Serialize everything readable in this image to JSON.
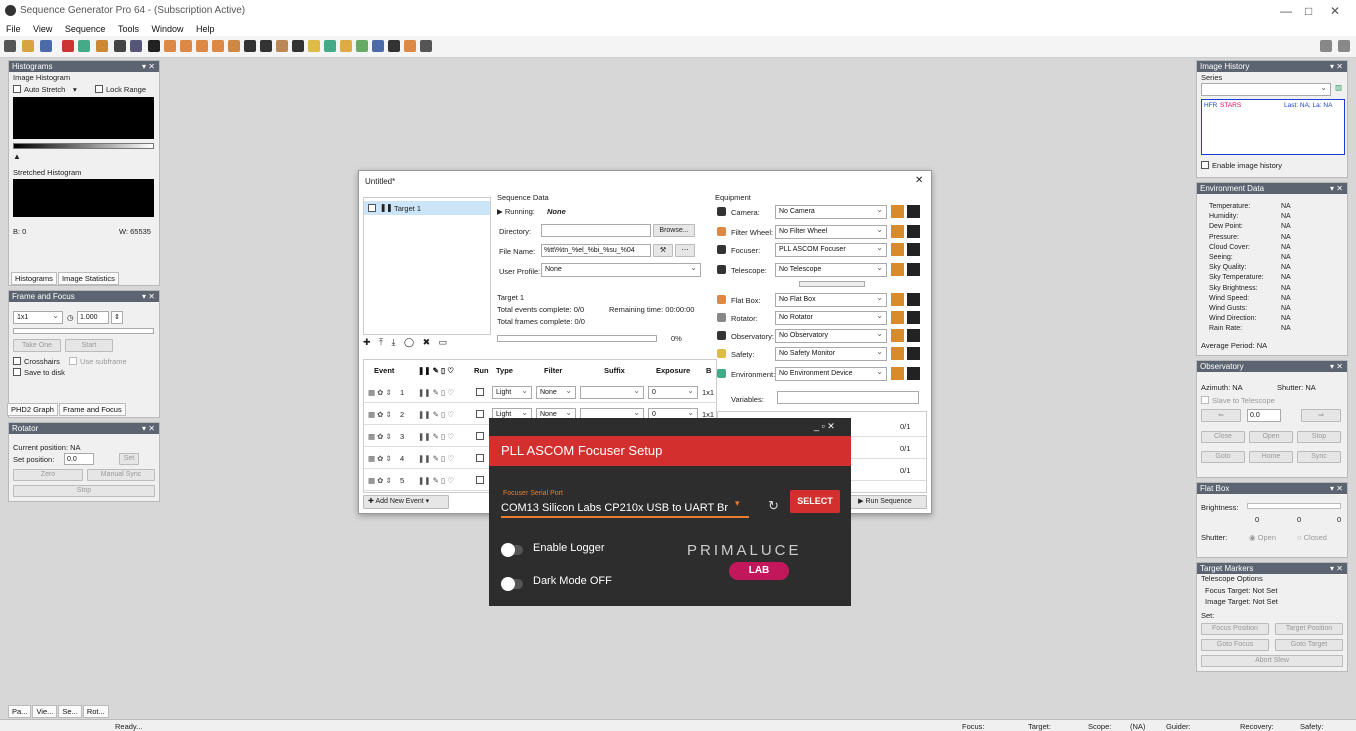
{
  "window": {
    "title": "Sequence Generator Pro 64 - (Subscription Active)",
    "minimize": "—",
    "maximize": "□",
    "close": "✕"
  },
  "menu": [
    "File",
    "View",
    "Sequence",
    "Tools",
    "Window",
    "Help"
  ],
  "left": {
    "histograms": {
      "title": "Histograms",
      "image_histogram": "Image Histogram",
      "auto_stretch": "Auto Stretch",
      "lock_range": "Lock Range",
      "stretched": "Stretched Histogram",
      "b": "B: 0",
      "w": "W: 65535",
      "tab_hist": "Histograms",
      "tab_stats": "Image Statistics"
    },
    "frame_focus": {
      "title": "Frame and Focus",
      "binning": "1x1",
      "exposure": "1.000",
      "take_one": "Take One",
      "start": "Start",
      "crosshairs": "Crosshairs",
      "use_subframe": "Use subframe",
      "save_to_disk": "Save to disk",
      "tab_phd2": "PHD2 Graph",
      "tab_ff": "Frame and Focus"
    },
    "rotator": {
      "title": "Rotator",
      "current": "Current position: NA",
      "set_position": "Set position:",
      "set_value": "0.0",
      "set": "Set",
      "zero": "Zero",
      "manual_sync": "Manual Sync",
      "stop": "Stop"
    },
    "bottom_tabs": [
      "Pa...",
      "Vie...",
      "Se...",
      "Rot..."
    ],
    "status": "Ready..."
  },
  "dialog": {
    "title": "Untitled*",
    "close": "✕",
    "target": "Target 1",
    "seq_data": {
      "header": "Sequence Data",
      "running_lbl": "Running:",
      "running_val": "None",
      "directory_lbl": "Directory:",
      "browse": "Browse...",
      "filename_lbl": "File Name:",
      "filename_val": "%tt\\%tn_%el_%bi_%su_%04",
      "profile_lbl": "User Profile:",
      "profile_val": "None"
    },
    "target_box": {
      "header": "Target 1",
      "events": "Total events complete: 0/0",
      "remaining": "Remaining time: 00:00:00",
      "frames": "Total frames complete: 0/0",
      "pct": "0%"
    },
    "equipment": {
      "header": "Equipment",
      "rows": [
        {
          "label": "Camera:",
          "value": "No Camera"
        },
        {
          "label": "Filter Wheel:",
          "value": "No Filter Wheel"
        },
        {
          "label": "Focuser:",
          "value": "PLL ASCOM Focuser"
        },
        {
          "label": "Telescope:",
          "value": "No Telescope"
        },
        {
          "label": "Flat Box:",
          "value": "No Flat Box"
        },
        {
          "label": "Rotator:",
          "value": "No Rotator"
        },
        {
          "label": "Observatory:",
          "value": "No Observatory"
        },
        {
          "label": "Safety:",
          "value": "No Safety Monitor"
        },
        {
          "label": "Environment:",
          "value": "No Environment Device"
        }
      ],
      "variables": "Variables:"
    },
    "grid": {
      "headers": [
        "Event",
        "Run",
        "Type",
        "Filter",
        "Suffix",
        "Exposure",
        "B"
      ],
      "rows": [
        {
          "n": "1",
          "type": "Light",
          "filter": "None",
          "exp": "0",
          "bin": "1x1",
          "progress": "0/1"
        },
        {
          "n": "2",
          "type": "Light",
          "filter": "None",
          "exp": "0",
          "bin": "1x1",
          "progress": "0/1"
        },
        {
          "n": "3",
          "type": "",
          "filter": "",
          "exp": "",
          "bin": "",
          "progress": "0/1"
        },
        {
          "n": "4",
          "type": "",
          "filter": "",
          "exp": "",
          "bin": "",
          "progress": "0/1"
        },
        {
          "n": "5",
          "type": "",
          "filter": "",
          "exp": "",
          "bin": "",
          "progress": "0/1"
        }
      ]
    },
    "add_event": "Add New Event",
    "run_sequence": "Run Sequence"
  },
  "focuser": {
    "title": "PLL ASCOM Focuser Setup",
    "port_label": "Focuser Serial Port",
    "port_value": "COM13  Silicon Labs CP210x USB to UART Br",
    "select": "SELECT",
    "enable_logger": "Enable Logger",
    "dark_mode": "Dark Mode OFF",
    "logo": "PRIMALUCE",
    "logo_sub": "LAB",
    "colors": {
      "accent": "#d32f2f",
      "bg": "#2d2d2d"
    }
  },
  "right": {
    "image_history": {
      "title": "Image History",
      "series": "Series",
      "hfr": "HFR",
      "stars": "STARS",
      "last": "Last: NA; La: NA",
      "enable": "Enable image history"
    },
    "environment": {
      "title": "Environment Data",
      "rows": [
        {
          "k": "Temperature:",
          "v": "NA"
        },
        {
          "k": "Humidity:",
          "v": "NA"
        },
        {
          "k": "Dew Point:",
          "v": "NA"
        },
        {
          "k": "Pressure:",
          "v": "NA"
        },
        {
          "k": "Cloud Cover:",
          "v": "NA"
        },
        {
          "k": "Seeing:",
          "v": "NA"
        },
        {
          "k": "Sky Quality:",
          "v": "NA"
        },
        {
          "k": "Sky Temperature:",
          "v": "NA"
        },
        {
          "k": "Sky Brightness:",
          "v": "NA"
        },
        {
          "k": "Wind Speed:",
          "v": "NA"
        },
        {
          "k": "Wind Gusts:",
          "v": "NA"
        },
        {
          "k": "Wind Direction:",
          "v": "NA"
        },
        {
          "k": "Rain Rate:",
          "v": "NA"
        }
      ],
      "avg": "Average Period:  NA"
    },
    "observatory": {
      "title": "Observatory",
      "azimuth": "Azimuth:  NA",
      "shutter": "Shutter:  NA",
      "slave": "Slave to Telescope",
      "value": "0.0",
      "close": "Close",
      "open": "Open",
      "stop": "Stop",
      "goto": "Goto",
      "home": "Home",
      "sync": "Sync"
    },
    "flatbox": {
      "title": "Flat Box",
      "brightness": "Brightness:",
      "v0": "0",
      "v1": "0",
      "v2": "0",
      "shutter": "Shutter:",
      "open": "Open",
      "closed": "Closed"
    },
    "target_markers": {
      "title": "Target Markers",
      "tel_opts": "Telescope Options",
      "focus_target": "Focus Target:  Not Set",
      "image_target": "Image Target:  Not Set",
      "set": "Set:",
      "focus_pos": "Focus Position",
      "target_pos": "Target Position",
      "goto_focus": "Goto Focus",
      "goto_target": "Goto Target",
      "abort": "Abort Slew"
    }
  },
  "statusbar": {
    "focus": "Focus:",
    "target": "Target:",
    "scope": "Scope:",
    "scope_val": "(NA)",
    "guider": "Guider:",
    "recovery": "Recovery:",
    "safety": "Safety:"
  }
}
